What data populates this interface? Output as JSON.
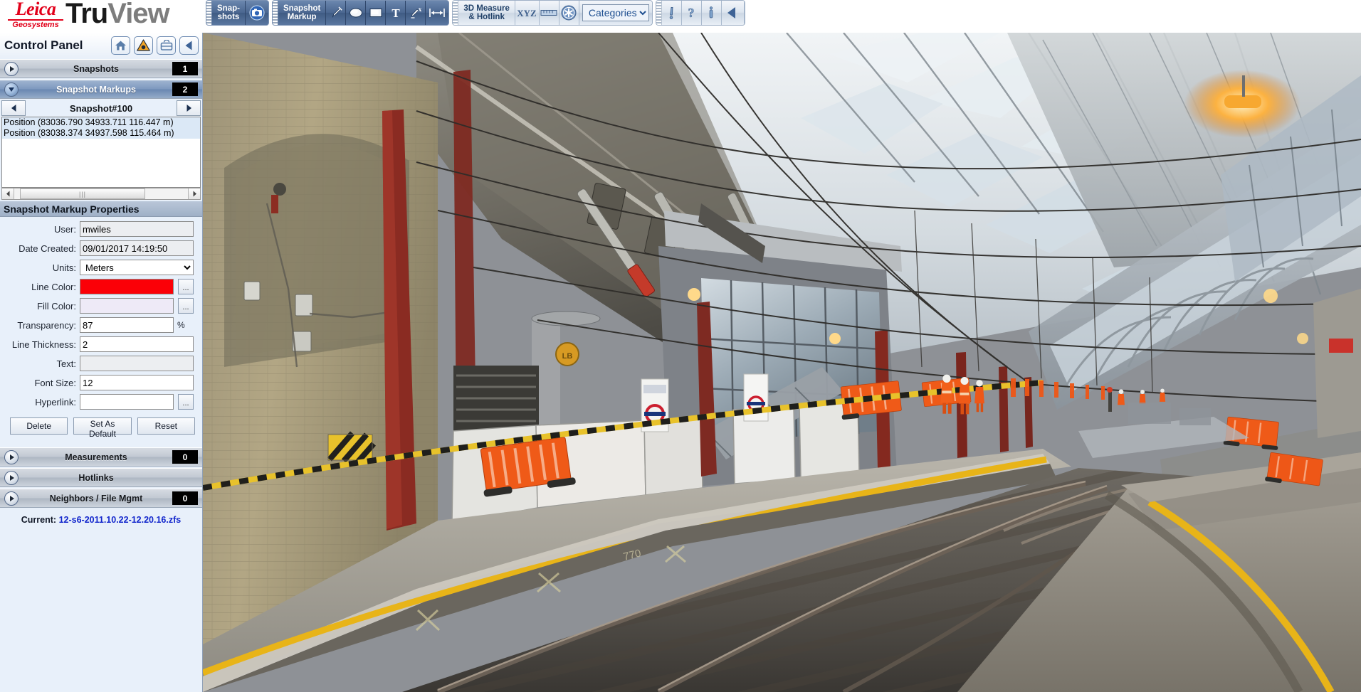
{
  "app": {
    "brand_primary": "Leica",
    "brand_sub": "Geosystems",
    "product_tru": "Tru",
    "product_view": "View",
    "brand_color": "#e2001a"
  },
  "toolbar": {
    "groups": [
      {
        "name": "snapshots",
        "label": "Snap-\nshots",
        "label_line1": "Snap-",
        "label_line2": "shots",
        "buttons": [
          {
            "name": "camera-icon",
            "title": "Take Snapshot"
          }
        ]
      },
      {
        "name": "snapshot-markup",
        "label_line1": "Snapshot",
        "label_line2": "Markup",
        "buttons": [
          {
            "name": "pen-icon",
            "title": "Freehand"
          },
          {
            "name": "ellipse-icon",
            "title": "Ellipse"
          },
          {
            "name": "rectangle-icon",
            "title": "Rectangle"
          },
          {
            "name": "text-icon",
            "title": "Text"
          },
          {
            "name": "delete-markup-icon",
            "title": "Delete Markup"
          },
          {
            "name": "measure-span-icon",
            "title": "Distance"
          }
        ]
      },
      {
        "name": "3d-measure-hotlink",
        "label_line1": "3D Measure",
        "label_line2": "& Hotlink",
        "buttons": [
          {
            "name": "xyz-icon",
            "title": "XYZ Point"
          },
          {
            "name": "ruler-icon",
            "title": "Distance"
          },
          {
            "name": "asterisk-icon",
            "title": "Hotlink"
          }
        ],
        "select": {
          "name": "categories-select",
          "value": "Categories",
          "options": [
            "Categories"
          ]
        }
      },
      {
        "name": "help-group",
        "buttons": [
          {
            "name": "info-icon",
            "title": "Information"
          },
          {
            "name": "help-icon",
            "title": "Help"
          },
          {
            "name": "about-icon",
            "title": "About"
          },
          {
            "name": "collapse-left-icon",
            "title": "Collapse"
          }
        ]
      }
    ]
  },
  "panel": {
    "title": "Control Panel",
    "head_buttons": [
      {
        "name": "home-button",
        "icon": "home-icon"
      },
      {
        "name": "warning-button",
        "icon": "warning-triangle-icon"
      },
      {
        "name": "print-button",
        "icon": "printer-icon"
      },
      {
        "name": "collapse-panel-button",
        "icon": "arrow-left-icon"
      }
    ],
    "sections": [
      {
        "name": "snapshots",
        "title": "Snapshots",
        "count": "1",
        "expanded": false,
        "has_count": true
      },
      {
        "name": "snapshot-markups",
        "title": "Snapshot Markups",
        "count": "2",
        "expanded": true,
        "has_count": true
      }
    ],
    "bottom_sections": [
      {
        "name": "measurements",
        "title": "Measurements",
        "count": "0",
        "expanded": false,
        "has_count": true
      },
      {
        "name": "hotlinks",
        "title": "Hotlinks",
        "count": "",
        "expanded": false,
        "has_count": false
      },
      {
        "name": "neighbors-file-mgmt",
        "title": "Neighbors / File Mgmt",
        "count": "0",
        "expanded": false,
        "has_count": true
      }
    ],
    "markup_nav": {
      "prev_label": "◀",
      "next_label": "▶",
      "current": "Snapshot#100"
    },
    "markup_list": [
      "Position (83036.790 34933.711 116.447 m)",
      "Position (83038.374 34937.598 115.464 m)"
    ],
    "properties": {
      "header": "Snapshot Markup Properties",
      "fields": [
        {
          "name": "user-field",
          "label": "User:",
          "value": "mwiles",
          "type": "text",
          "readonly": true,
          "extra": null
        },
        {
          "name": "date-created-field",
          "label": "Date Created:",
          "value": "09/01/2017 14:19:50",
          "type": "text",
          "readonly": true,
          "extra": null
        },
        {
          "name": "units-select",
          "label": "Units:",
          "value": "Meters",
          "type": "select",
          "readonly": false,
          "extra": null
        },
        {
          "name": "line-color-swatch",
          "label": "Line Color:",
          "value": "#fb0007",
          "type": "color",
          "readonly": false,
          "extra": "..."
        },
        {
          "name": "fill-color-swatch",
          "label": "Fill Color:",
          "value": "#eeeaf7",
          "type": "color",
          "readonly": false,
          "extra": "..."
        },
        {
          "name": "transparency-field",
          "label": "Transparency:",
          "value": "87",
          "type": "text",
          "readonly": false,
          "extra": "%"
        },
        {
          "name": "line-thickness-field",
          "label": "Line Thickness:",
          "value": "2",
          "type": "text",
          "readonly": false,
          "extra": null
        },
        {
          "name": "text-field",
          "label": "Text:",
          "value": "",
          "type": "text",
          "readonly": true,
          "extra": null
        },
        {
          "name": "font-size-field",
          "label": "Font Size:",
          "value": "12",
          "type": "text",
          "readonly": false,
          "extra": null
        },
        {
          "name": "hyperlink-field",
          "label": "Hyperlink:",
          "value": "",
          "type": "text",
          "readonly": false,
          "extra": "..."
        }
      ],
      "units_options": [
        "Meters"
      ],
      "buttons": [
        {
          "name": "delete-button",
          "label": "Delete"
        },
        {
          "name": "set-as-default-button",
          "label": "Set As Default"
        },
        {
          "name": "reset-button",
          "label": "Reset"
        }
      ]
    },
    "current_label": "Current:",
    "current_file": "12-s6-2011.10.22-12.20.16.zfs"
  },
  "viewer": {
    "name": "panoramic-viewer",
    "description": "360 panoramic laser-scan photo of a railway station platform under construction"
  }
}
